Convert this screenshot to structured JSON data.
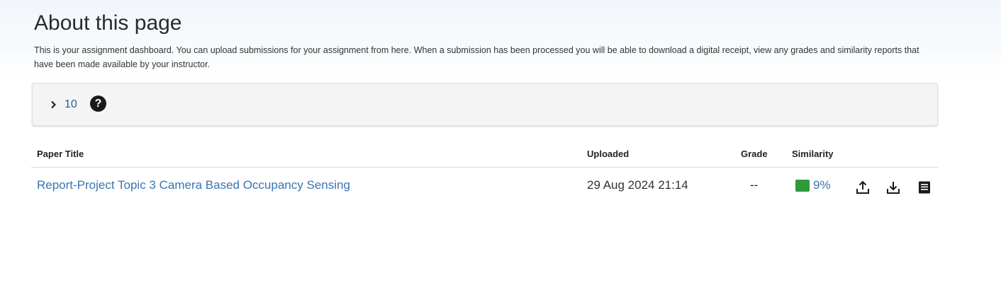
{
  "about": {
    "title": "About this page",
    "description": "This is your assignment dashboard. You can upload submissions for your assignment from here. When a submission has been processed you will be able to download a digital receipt, view any grades and similarity reports that have been made available by your instructor."
  },
  "assignment": {
    "title": "10",
    "help_label": "?"
  },
  "table": {
    "headers": {
      "paper_title": "Paper Title",
      "uploaded": "Uploaded",
      "grade": "Grade",
      "similarity": "Similarity"
    },
    "rows": [
      {
        "paper_title": "Report-Project Topic 3 Camera Based Occupancy Sensing",
        "uploaded": "29 Aug 2024 21:14",
        "grade": "--",
        "similarity": "9%",
        "similarity_color": "#2e9a3c"
      }
    ]
  },
  "icons": {
    "expand": "chevron-right-icon",
    "help": "question-circle-icon",
    "upload": "upload-icon",
    "download": "download-icon",
    "receipt": "receipt-icon"
  }
}
